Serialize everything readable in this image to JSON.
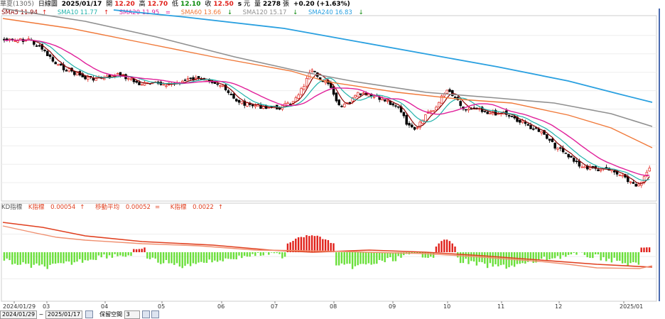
{
  "header": {
    "stock": "華夏(1305)",
    "period": "日線圖",
    "date": "2025/01/17",
    "open_label": "開",
    "open": "12.20",
    "high_label": "高",
    "high": "12.70",
    "low_label": "低",
    "low": "12.10",
    "close_label": "收",
    "close": "12.50",
    "s_label": "s",
    "currency": "元",
    "vol_label": "量",
    "volume": "2278",
    "vol_unit": "張",
    "change": "+0.20 (+1.63%)"
  },
  "ma_legend": [
    {
      "label": "SMA5 11.94",
      "arrow": "↑",
      "color": "#8b0000"
    },
    {
      "label": "SMA10 11.77",
      "arrow": "↑",
      "color": "#20b2aa"
    },
    {
      "label": "SMA20 11.95",
      "arrow": "=",
      "color": "#e0209a"
    },
    {
      "label": "SMA60 13.66",
      "arrow": "↓",
      "color": "#f07838"
    },
    {
      "label": "SMA120 15.17",
      "arrow": "↓",
      "color": "#909090"
    },
    {
      "label": "SMA240 16.83",
      "arrow": "↓",
      "color": "#2aa0e0"
    }
  ],
  "ind_legend": {
    "title": "KD指標",
    "k_label": "K指標",
    "k_value": "0.00054",
    "k_arrow": "↑",
    "ma_label": "移動平均",
    "ma_value": "0.00052",
    "ma_arrow": "=",
    "d_label": "K指標",
    "d_value": "0.0022",
    "d_arrow": "↑"
  },
  "x_labels": [
    "2024/01/29",
    "03",
    "04",
    "05",
    "06",
    "07",
    "08",
    "09",
    "10",
    "11",
    "12",
    "2025/01"
  ],
  "bottom": {
    "start_date": "2024/01/29",
    "sep": "~",
    "end_date": "2025/01/17",
    "keep_label": "保留空間",
    "keep_value": "3"
  },
  "colors": {
    "up": "#e0201a",
    "down": "#000000",
    "hist_pos": "#e0201a",
    "hist_neg": "#6adf3a",
    "k_line": "#e04020",
    "d_line": "#f09070"
  },
  "chart_data": {
    "type": "candlestick",
    "sma_last": {
      "SMA5": 11.94,
      "SMA10": 11.77,
      "SMA20": 11.95,
      "SMA60": 13.66,
      "SMA120": 15.17,
      "SMA240": 16.83
    },
    "last_bar": {
      "date": "2025/01/17",
      "open": 12.2,
      "high": 12.7,
      "low": 12.1,
      "close": 12.5,
      "volume": 2278
    }
  }
}
